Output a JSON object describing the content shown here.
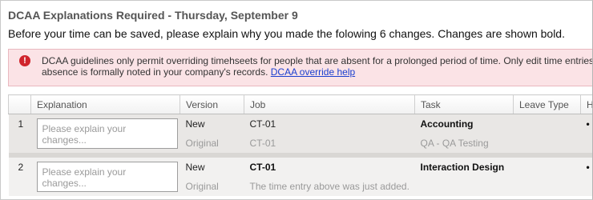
{
  "header": {
    "title": "DCAA Explanations Required  - Thursday, September 9",
    "instructions": "Before your time can be saved, please explain why you made the folowing 6 changes. Changes are shown bold."
  },
  "alert": {
    "icon": "error-icon",
    "text_line1": "DCAA guidelines only permit overriding timehseets for people that are absent for a prolonged period of time. Only edit time entries for S",
    "text_line2": "absence is formally noted in your company's records.",
    "link_label": "DCAA override help"
  },
  "table": {
    "columns": [
      "",
      "Explanation",
      "Version",
      "Job",
      "Task",
      "Leave Type",
      "Ho"
    ],
    "rows": [
      {
        "number": "1",
        "explanation_placeholder": "Please explain your changes...",
        "new_version_label": "New",
        "new_job": "CT-01",
        "new_task": "Accounting",
        "original_version_label": "Original",
        "original_job": "CT-01",
        "original_task": "QA - QA Testing",
        "hours_fragment": "•"
      },
      {
        "number": "2",
        "explanation_placeholder": "Please explain your changes...",
        "new_version_label": "New",
        "new_job": "CT-01",
        "new_task": "Interaction Design",
        "original_version_label": "Original",
        "original_job": "The time entry above was just added.",
        "original_task": "",
        "hours_fragment": "•"
      }
    ]
  },
  "colors": {
    "alert_background": "#fbe3e6",
    "alert_icon": "#d0242c",
    "link": "#1a3fcf"
  }
}
